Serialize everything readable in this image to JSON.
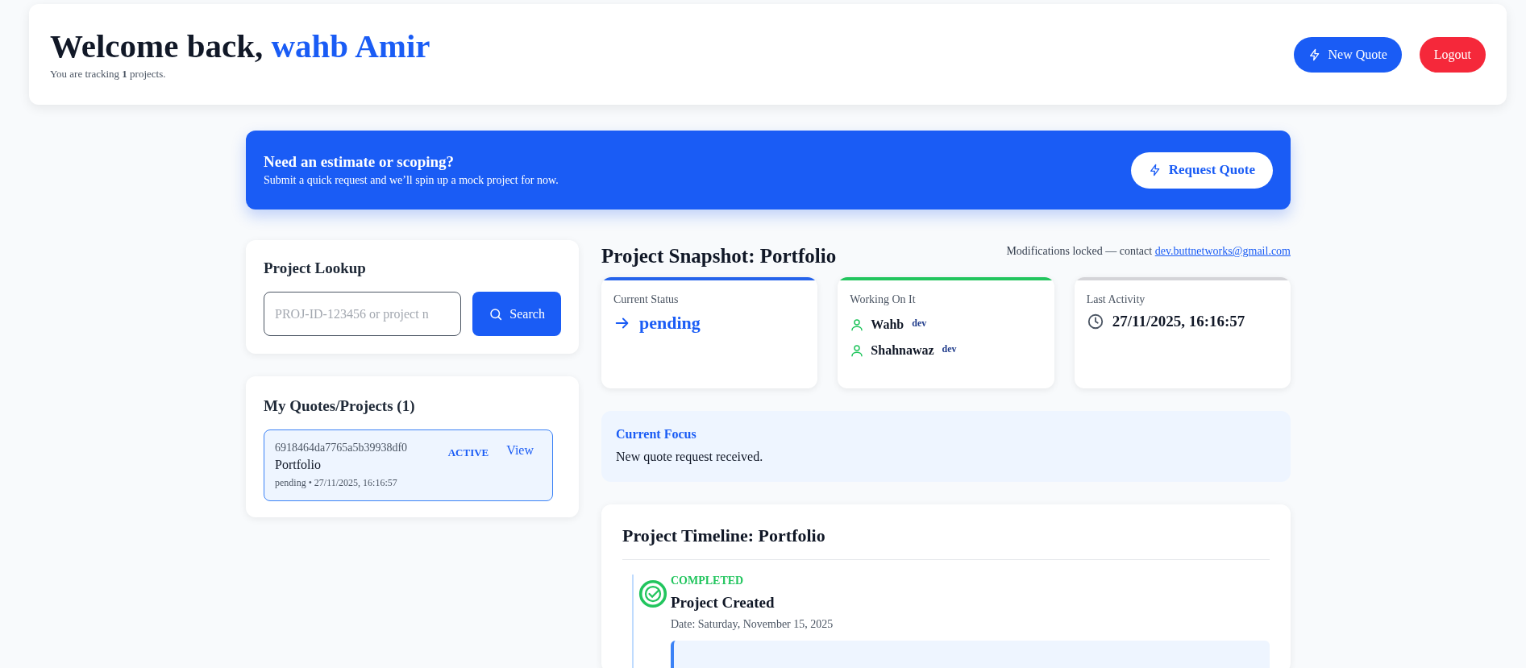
{
  "header": {
    "greeting": "Welcome back,",
    "user_name": "wahb Amir",
    "subtitle": "You are tracking **1** projects.",
    "buttons": [
      {
        "label": "New Quote",
        "kind": "primary"
      },
      {
        "label": "Logout",
        "kind": "danger"
      }
    ]
  },
  "banner": {
    "title": "Need an estimate or scoping?",
    "text": "Submit a quick request and we’ll spin up a mock project for now.",
    "button": "Request Quote"
  },
  "lookup": {
    "title": "Project Lookup",
    "placeholder": "PROJ-ID-123456 or project n",
    "button": "Search"
  },
  "quotes": {
    "title": "My Quotes/Projects (1)",
    "items": [
      {
        "id": "6918464da7765a5b39938df0",
        "name": "Portfolio",
        "meta": "pending • 27/11/2025, 16:16:57",
        "badge": "ACTIVE",
        "action": "View",
        "selected": true
      }
    ]
  },
  "snapshot": {
    "title": "Project Snapshot: Portfolio",
    "notice": "Modifications locked — contact",
    "email": "dev.buttnetworks@gmail.com",
    "cards": [
      {
        "kind": "status",
        "label": "Current Status",
        "color": "#2563eb",
        "value": "pending"
      },
      {
        "kind": "team",
        "label": "Working On It",
        "color": "#22c55e",
        "members": [
          {
            "name": "Wahb",
            "role": "dev"
          },
          {
            "name": "Shahnawaz",
            "role": "dev"
          }
        ]
      },
      {
        "kind": "activity",
        "label": "Last Activity",
        "color": "#d4d4d8",
        "value": "27/11/2025, 16:16:57"
      }
    ],
    "focus": {
      "title": "Current Focus",
      "text": "New quote request received."
    }
  },
  "timeline": {
    "title": "Project Timeline: Portfolio",
    "items": [
      {
        "kind": "completed",
        "status": "COMPLETED",
        "title": "Project Created",
        "date": "Date: Saturday, November 15, 2025"
      }
    ]
  }
}
